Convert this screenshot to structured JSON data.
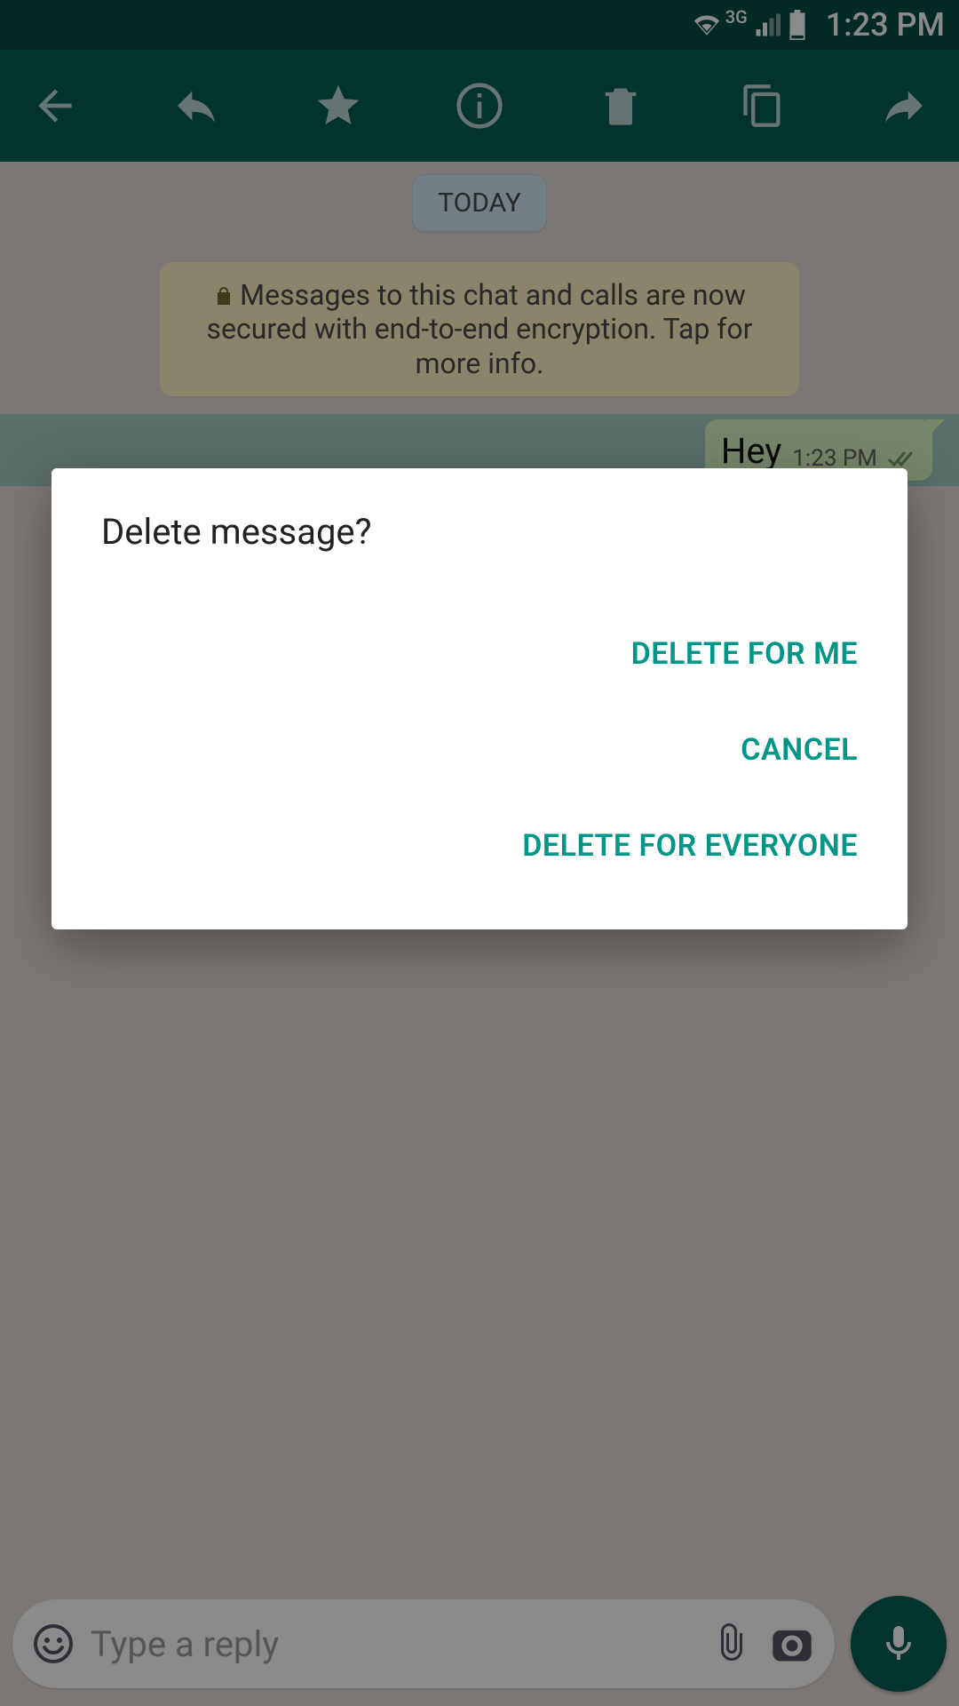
{
  "status": {
    "network_label": "3G",
    "time": "1:23 PM"
  },
  "chat": {
    "date_label": "TODAY",
    "encryption_notice": "Messages to this chat and calls are now secured with end-to-end encryption. Tap for more info.",
    "messages": [
      {
        "text": "Hey",
        "time": "1:23 PM"
      }
    ]
  },
  "composer": {
    "placeholder": "Type a reply"
  },
  "dialog": {
    "title": "Delete message?",
    "delete_for_me": "DELETE FOR ME",
    "cancel": "CANCEL",
    "delete_for_everyone": "DELETE FOR EVERYONE"
  },
  "colors": {
    "primary": "#075e54",
    "primary_dark": "#054d44",
    "accent": "#009688",
    "bubble_out": "#dcf8c6"
  }
}
